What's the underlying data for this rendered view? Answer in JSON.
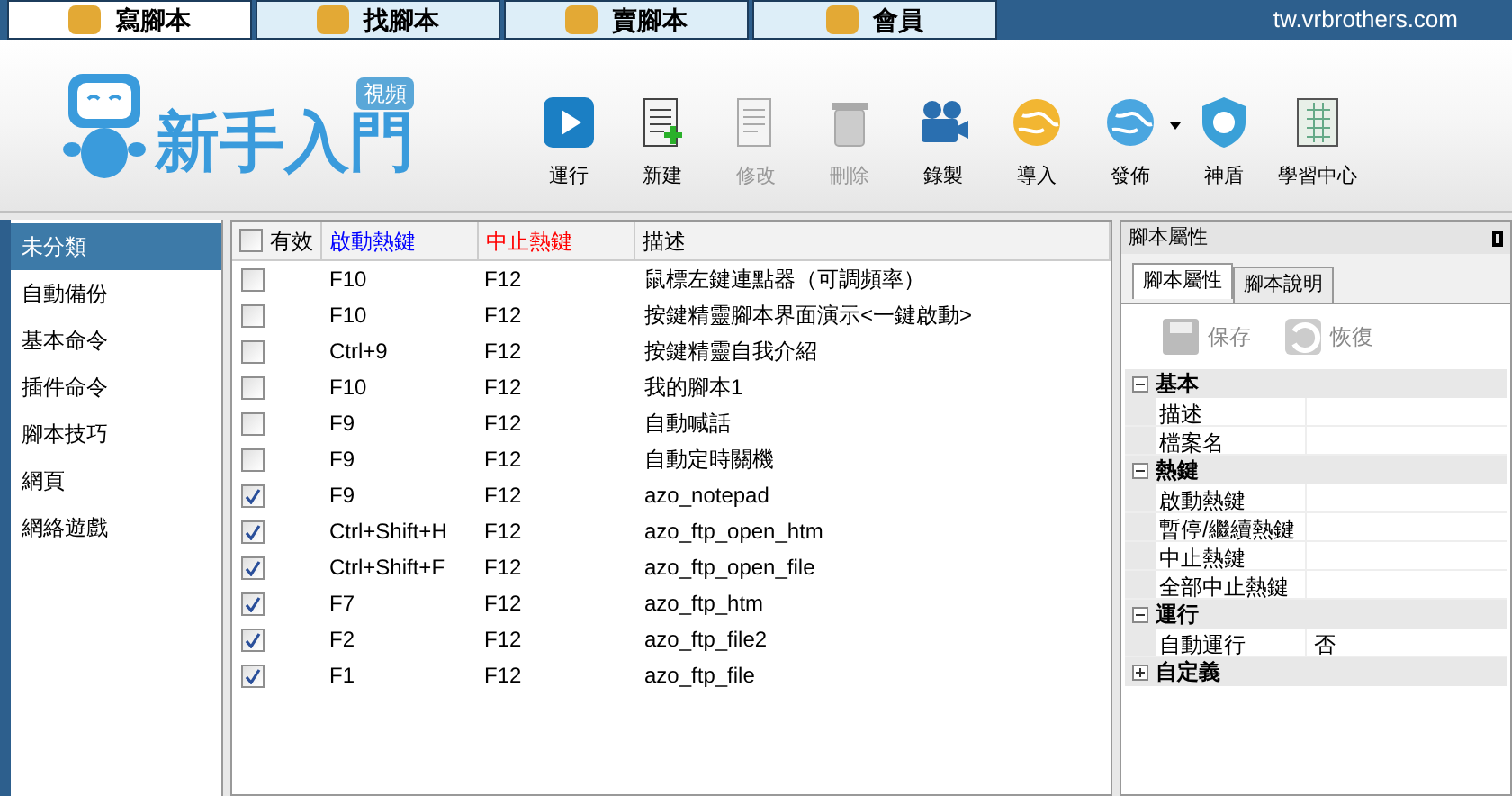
{
  "tabs": [
    {
      "label": "寫腳本",
      "selected": true
    },
    {
      "label": "找腳本",
      "selected": false
    },
    {
      "label": "賣腳本",
      "selected": false
    },
    {
      "label": "會員",
      "selected": false
    }
  ],
  "site_url": "tw.vrbrothers.com",
  "banner": {
    "title": "新手入門",
    "badge": "視頻"
  },
  "toolbar": [
    {
      "label": "運行",
      "disabled": false
    },
    {
      "label": "新建",
      "disabled": false
    },
    {
      "label": "修改",
      "disabled": true
    },
    {
      "label": "刪除",
      "disabled": true
    },
    {
      "label": "錄製",
      "disabled": false
    },
    {
      "label": "導入",
      "disabled": false
    },
    {
      "label": "發佈",
      "disabled": false,
      "dropdown": true
    },
    {
      "label": "神盾",
      "disabled": false
    },
    {
      "label": "學習中心",
      "disabled": false
    }
  ],
  "sidebar": {
    "items": [
      {
        "label": "未分類",
        "selected": true
      },
      {
        "label": "自動備份",
        "selected": false
      },
      {
        "label": "基本命令",
        "selected": false
      },
      {
        "label": "插件命令",
        "selected": false
      },
      {
        "label": "腳本技巧",
        "selected": false
      },
      {
        "label": "網頁",
        "selected": false
      },
      {
        "label": "網絡遊戲",
        "selected": false
      }
    ]
  },
  "table": {
    "header_checked": false,
    "columns": [
      {
        "label": "有效",
        "color": "#000000"
      },
      {
        "label": "啟動熱鍵",
        "color": "#0000ff"
      },
      {
        "label": "中止熱鍵",
        "color": "#ff0000"
      },
      {
        "label": "描述",
        "color": "#000000"
      }
    ],
    "rows": [
      {
        "checked": false,
        "start": "F10",
        "stop": "F12",
        "description": "鼠標左鍵連點器（可調頻率）"
      },
      {
        "checked": false,
        "start": "F10",
        "stop": "F12",
        "description": "按鍵精靈腳本界面演示<一鍵啟動>"
      },
      {
        "checked": false,
        "start": "Ctrl+9",
        "stop": "F12",
        "description": "按鍵精靈自我介紹"
      },
      {
        "checked": false,
        "start": "F10",
        "stop": "F12",
        "description": "我的腳本1"
      },
      {
        "checked": false,
        "start": "F9",
        "stop": "F12",
        "description": "自動喊話"
      },
      {
        "checked": false,
        "start": "F9",
        "stop": "F12",
        "description": "自動定時關機"
      },
      {
        "checked": true,
        "start": "F9",
        "stop": "F12",
        "description": "azo_notepad"
      },
      {
        "checked": true,
        "start": "Ctrl+Shift+H",
        "stop": "F12",
        "description": "azo_ftp_open_htm"
      },
      {
        "checked": true,
        "start": "Ctrl+Shift+F",
        "stop": "F12",
        "description": "azo_ftp_open_file"
      },
      {
        "checked": true,
        "start": "F7",
        "stop": "F12",
        "description": "azo_ftp_htm"
      },
      {
        "checked": true,
        "start": "F2",
        "stop": "F12",
        "description": "azo_ftp_file2"
      },
      {
        "checked": true,
        "start": "F1",
        "stop": "F12",
        "description": "azo_ftp_file"
      }
    ]
  },
  "properties_panel": {
    "title": "腳本屬性",
    "tabs": [
      {
        "label": "腳本屬性",
        "selected": true
      },
      {
        "label": "腳本說明",
        "selected": false
      }
    ],
    "actions": [
      {
        "label": "保存",
        "kind": "save"
      },
      {
        "label": "恢復",
        "kind": "restore"
      }
    ],
    "groups": [
      {
        "label": "基本",
        "expanded": true,
        "rows": [
          {
            "name": "描述"
          },
          {
            "name": "檔案名"
          }
        ]
      },
      {
        "label": "熱鍵",
        "expanded": true,
        "rows": [
          {
            "name": "啟動熱鍵"
          },
          {
            "name": "暫停/繼續熱鍵"
          },
          {
            "name": "中止熱鍵"
          },
          {
            "name": "全部中止熱鍵"
          }
        ]
      },
      {
        "label": "運行",
        "expanded": true,
        "rows": [
          {
            "name": "自動運行",
            "value": "否"
          }
        ]
      },
      {
        "label": "自定義",
        "expanded": false
      }
    ]
  }
}
